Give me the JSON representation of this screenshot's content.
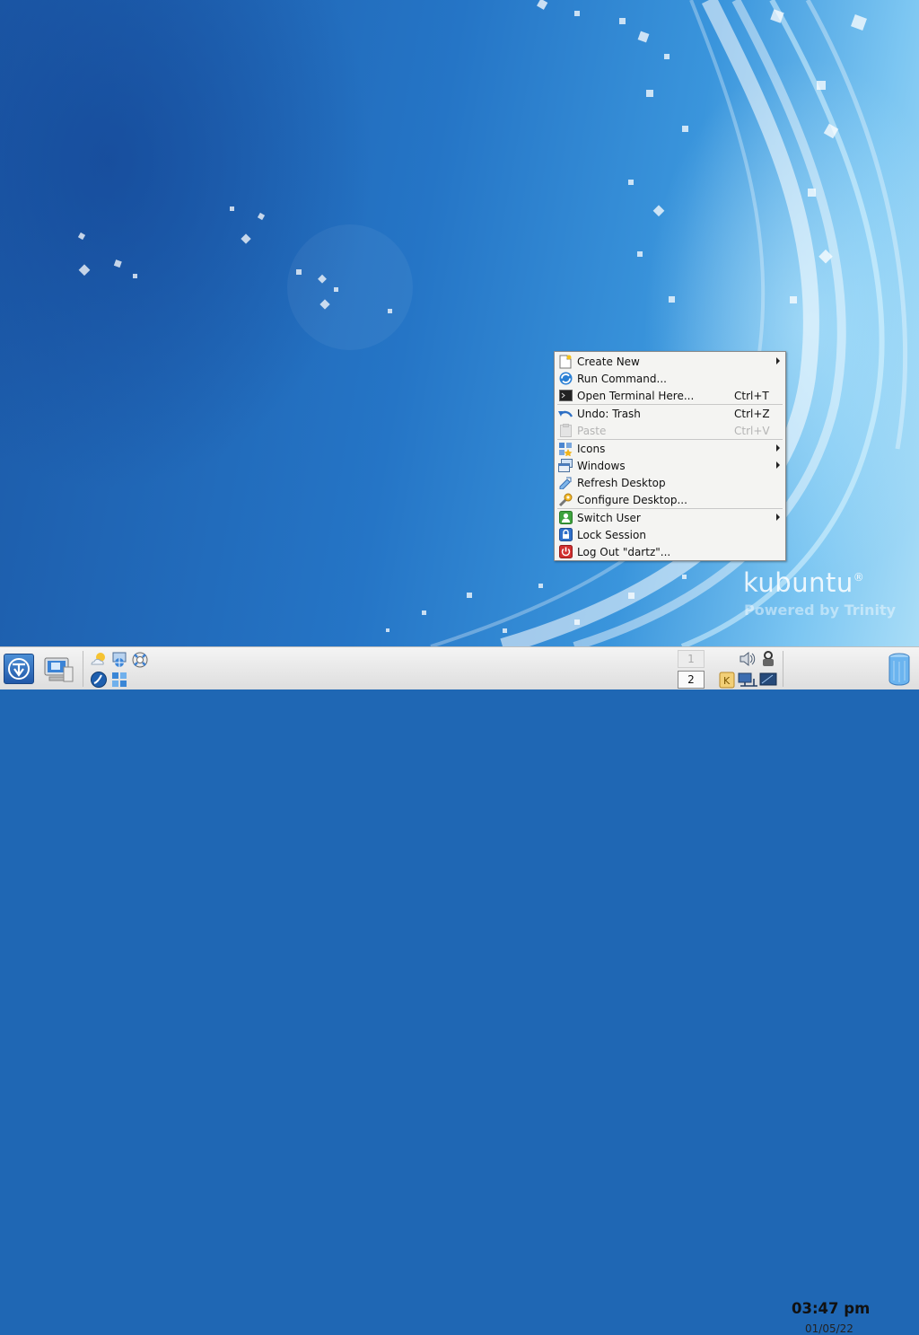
{
  "desktop": {
    "brand": {
      "name": "kubuntu",
      "mark": "®",
      "tagline": "Powered by Trinity"
    }
  },
  "context_menu": {
    "items": [
      {
        "label": "Create New",
        "shortcut": "",
        "submenu": true,
        "enabled": true,
        "icon": "new-file-icon"
      },
      {
        "label": "Run Command...",
        "shortcut": "",
        "submenu": false,
        "enabled": true,
        "icon": "run-command-icon"
      },
      {
        "label": "Open Terminal Here...",
        "shortcut": "Ctrl+T",
        "submenu": false,
        "enabled": true,
        "icon": "terminal-icon"
      },
      {
        "label": "Undo: Trash",
        "shortcut": "Ctrl+Z",
        "submenu": false,
        "enabled": true,
        "icon": "undo-icon"
      },
      {
        "label": "Paste",
        "shortcut": "Ctrl+V",
        "submenu": false,
        "enabled": false,
        "icon": "paste-icon"
      },
      {
        "label": "Icons",
        "shortcut": "",
        "submenu": true,
        "enabled": true,
        "icon": "icons-icon"
      },
      {
        "label": "Windows",
        "shortcut": "",
        "submenu": true,
        "enabled": true,
        "icon": "windows-icon"
      },
      {
        "label": "Refresh Desktop",
        "shortcut": "",
        "submenu": false,
        "enabled": true,
        "icon": "refresh-icon"
      },
      {
        "label": "Configure Desktop...",
        "shortcut": "",
        "submenu": false,
        "enabled": true,
        "icon": "configure-icon"
      },
      {
        "label": "Switch User",
        "shortcut": "",
        "submenu": true,
        "enabled": true,
        "icon": "switch-user-icon"
      },
      {
        "label": "Lock Session",
        "shortcut": "",
        "submenu": false,
        "enabled": true,
        "icon": "lock-icon"
      },
      {
        "label": "Log Out \"dartz\"...",
        "shortcut": "",
        "submenu": false,
        "enabled": true,
        "icon": "logout-icon"
      }
    ]
  },
  "taskbar": {
    "pager": {
      "desktops": [
        "1",
        "2"
      ],
      "current": "2"
    },
    "clock": {
      "time": "03:47 pm",
      "date": "01/05/22"
    }
  }
}
